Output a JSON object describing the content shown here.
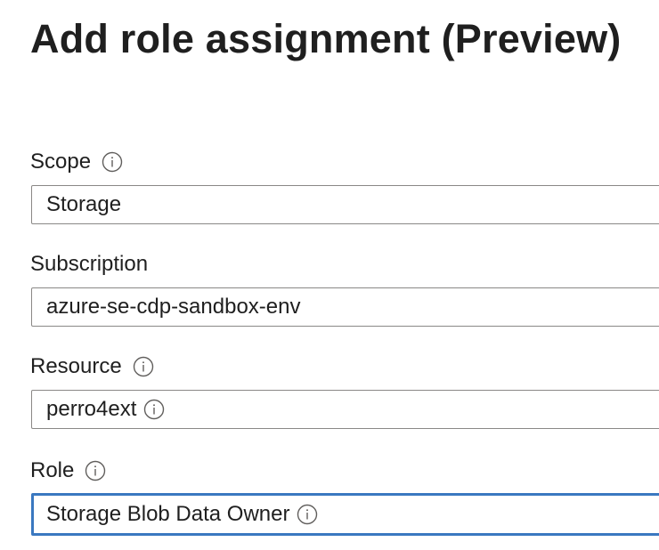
{
  "page": {
    "title": "Add role assignment (Preview)"
  },
  "fields": {
    "scope": {
      "label": "Scope",
      "value": "Storage",
      "label_icon": "info-icon"
    },
    "subscription": {
      "label": "Subscription",
      "value": "azure-se-cdp-sandbox-env"
    },
    "resource": {
      "label": "Resource",
      "value": "perro4ext",
      "label_icon": "info-icon",
      "value_icon": "info-icon"
    },
    "role": {
      "label": "Role",
      "value": "Storage Blob Data Owner",
      "label_icon": "info-icon",
      "value_icon": "info-icon",
      "focused": true
    }
  },
  "colors": {
    "text": "#1f1f1f",
    "border": "#8a8886",
    "focus_border": "#3a78c0",
    "icon": "#605e5c"
  }
}
